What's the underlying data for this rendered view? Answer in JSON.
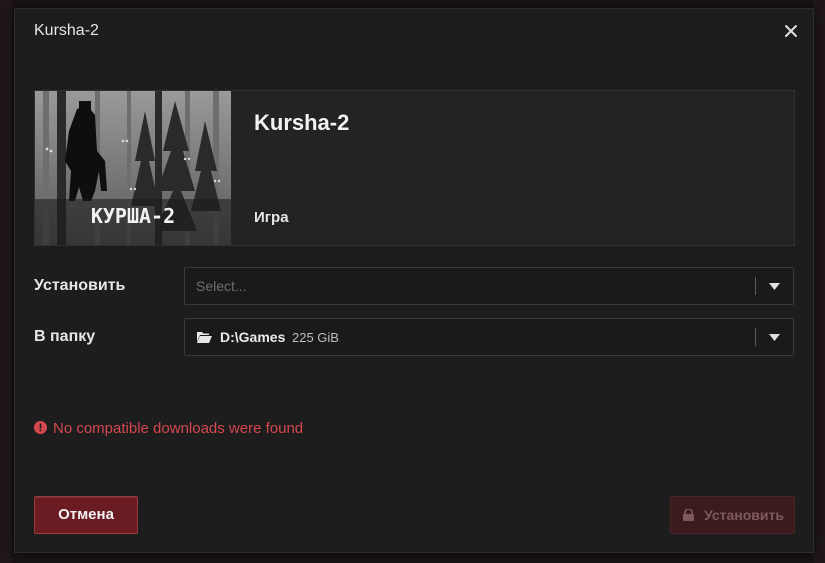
{
  "dialog": {
    "title": "Kursha-2",
    "close_icon": "close-icon"
  },
  "game": {
    "name": "Kursha-2",
    "type": "Игра",
    "cover_text": "КУРША-2"
  },
  "form": {
    "install_label": "Установить",
    "install_placeholder": "Select...",
    "folder_label": "В папку",
    "folder_value": "D:\\Games",
    "folder_free_space": "225 GiB"
  },
  "error": {
    "message": "No compatible downloads were found",
    "color": "#d4484e"
  },
  "buttons": {
    "cancel": "Отмена",
    "install": "Установить"
  },
  "colors": {
    "accent": "#6a1c22",
    "disabled_button": "#3b1b1d"
  }
}
